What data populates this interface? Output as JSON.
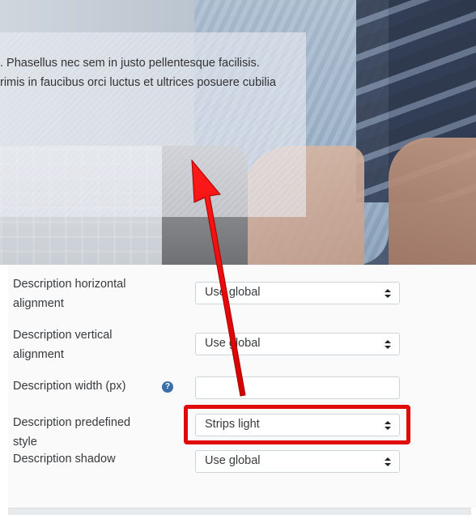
{
  "preview": {
    "description_lines": [
      ". Phasellus nec sem in justo pellentesque facilisis.",
      "rimis in faucibus orci luctus et ultrices posuere cubilia"
    ]
  },
  "form": {
    "fields": [
      {
        "label": "Description horizontal alignment",
        "type": "select",
        "value": "Use global"
      },
      {
        "label": "Description vertical alignment",
        "type": "select",
        "value": "Use global"
      },
      {
        "label": "Description width (px)",
        "type": "text",
        "value": "",
        "help": "?"
      },
      {
        "label": "Description predefined style",
        "type": "select",
        "value": "Strips light"
      },
      {
        "label": "Description shadow",
        "type": "select",
        "value": "Use global"
      }
    ]
  },
  "colors": {
    "annotation_red": "#e10a0a",
    "help_icon": "#3a6ea8"
  },
  "icons": {
    "select_arrows": "sort-arrows-icon",
    "help": "question-circle-icon",
    "annotation": "arrow-up-icon"
  }
}
